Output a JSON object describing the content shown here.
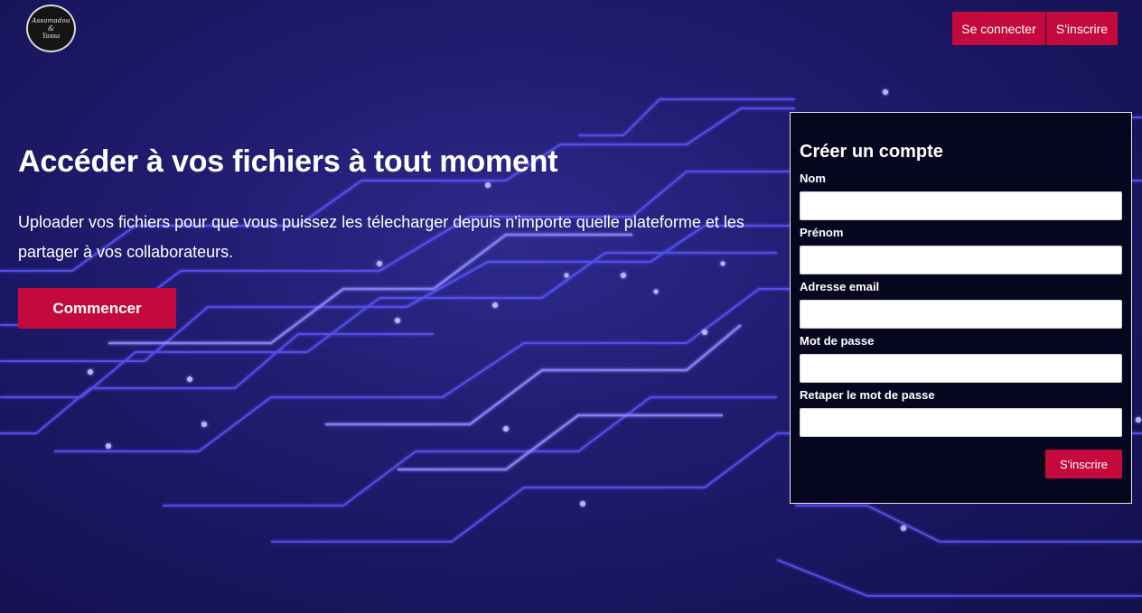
{
  "logo": {
    "line1": "Assamadou",
    "line2": "&",
    "line3": "Yassa"
  },
  "nav": {
    "login_label": "Se connecter",
    "signup_label": "S'inscrire"
  },
  "hero": {
    "title": "Accéder à vos fichiers à tout moment",
    "subtitle": "Uploader vos fichiers pour que vous puissez les télecharger depuis n'importe quelle plateforme et les partager à vos collaborateurs.",
    "cta_label": "Commencer"
  },
  "signup_form": {
    "title": "Créer un compte",
    "fields": [
      {
        "label": "Nom",
        "value": ""
      },
      {
        "label": "Prénom",
        "value": ""
      },
      {
        "label": "Adresse email",
        "value": ""
      },
      {
        "label": "Mot de passe",
        "value": ""
      },
      {
        "label": "Retaper le mot de passe",
        "value": ""
      }
    ],
    "submit_label": "S'inscrire"
  },
  "colors": {
    "accent": "#c4093d",
    "background": "#1e1a6a",
    "circuit": "#5a55ff"
  }
}
